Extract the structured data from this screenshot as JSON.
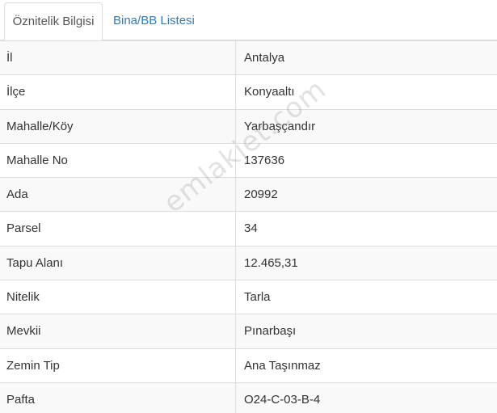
{
  "tabs": [
    {
      "label": "Öznitelik Bilgisi",
      "active": true
    },
    {
      "label": "Bina/BB Listesi",
      "active": false
    }
  ],
  "rows": [
    {
      "label": "İl",
      "value": "Antalya"
    },
    {
      "label": "İlçe",
      "value": "Konyaaltı"
    },
    {
      "label": "Mahalle/Köy",
      "value": "Yarbaşçandır"
    },
    {
      "label": "Mahalle No",
      "value": "137636"
    },
    {
      "label": "Ada",
      "value": "20992"
    },
    {
      "label": "Parsel",
      "value": "34"
    },
    {
      "label": "Tapu Alanı",
      "value": "12.465,31"
    },
    {
      "label": "Nitelik",
      "value": "Tarla"
    },
    {
      "label": "Mevkii",
      "value": "Pınarbaşı"
    },
    {
      "label": "Zemin Tip",
      "value": "Ana Taşınmaz"
    },
    {
      "label": "Pafta",
      "value": "O24-C-03-B-4"
    }
  ],
  "watermark": "emlakjet.com",
  "colors": {
    "link": "#337ab7",
    "border": "#dddddd",
    "stripe": "#f9f9f9"
  }
}
